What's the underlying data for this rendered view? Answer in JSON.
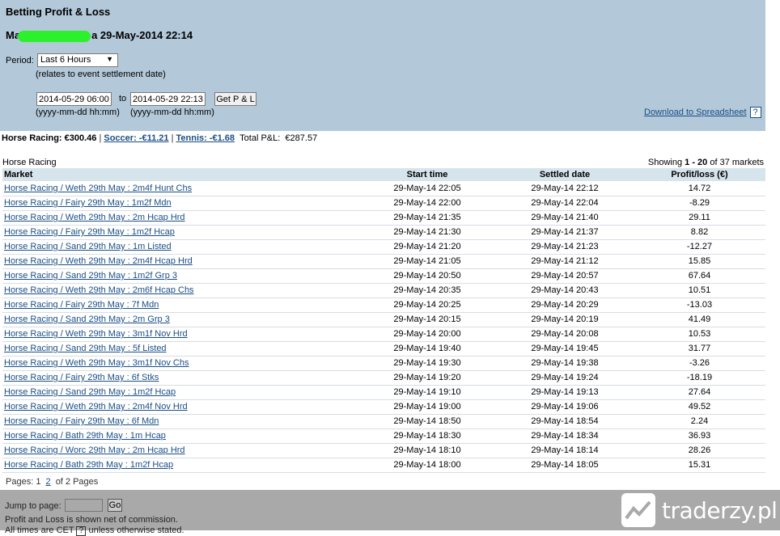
{
  "header": {
    "title": "Betting Profit & Loss",
    "account_prefix": "Ma",
    "account_suffix": "a 29-May-2014 22:14",
    "period_label": "Period:",
    "period_value": "Last 6 Hours",
    "period_note": "(relates to event settlement date)",
    "date_from": "2014-05-29 06:00",
    "to_label": "to",
    "date_to": "2014-05-29 22:13",
    "get_button": "Get P & L",
    "format_hint_from": "(yyyy-mm-dd hh:mm)",
    "format_hint_to": "(yyyy-mm-dd hh:mm)",
    "download_link": "Download to Spreadsheet",
    "help_mark": "?"
  },
  "summary": {
    "horse_racing": "Horse Racing: €300.46",
    "soccer": "Soccer: -€11.21",
    "tennis": "Tennis: -€1.68",
    "total_label": "Total P&L:",
    "total_value": "€287.57",
    "separator": "|"
  },
  "section": {
    "title": "Horse Racing",
    "showing_prefix": "Showing",
    "showing_range": "1 - 20",
    "showing_suffix": "of 37 markets"
  },
  "table": {
    "headers": {
      "market": "Market",
      "start": "Start time",
      "settled": "Settled date",
      "pl": "Profit/loss (€)"
    },
    "rows": [
      {
        "market": "Horse Racing / Weth 29th May : 2m4f Hunt Chs",
        "start": "29-May-14 22:05",
        "settled": "29-May-14 22:12",
        "pl": "14.72"
      },
      {
        "market": "Horse Racing / Fairy 29th May : 1m2f Mdn",
        "start": "29-May-14 22:00",
        "settled": "29-May-14 22:04",
        "pl": "-8.29"
      },
      {
        "market": "Horse Racing / Weth 29th May : 2m Hcap Hrd",
        "start": "29-May-14 21:35",
        "settled": "29-May-14 21:40",
        "pl": "29.11"
      },
      {
        "market": "Horse Racing / Fairy 29th May : 1m2f Hcap",
        "start": "29-May-14 21:30",
        "settled": "29-May-14 21:37",
        "pl": "8.82"
      },
      {
        "market": "Horse Racing / Sand 29th May : 1m Listed",
        "start": "29-May-14 21:20",
        "settled": "29-May-14 21:23",
        "pl": "-12.27"
      },
      {
        "market": "Horse Racing / Weth 29th May : 2m4f Hcap Hrd",
        "start": "29-May-14 21:05",
        "settled": "29-May-14 21:12",
        "pl": "15.85"
      },
      {
        "market": "Horse Racing / Sand 29th May : 1m2f Grp 3",
        "start": "29-May-14 20:50",
        "settled": "29-May-14 20:57",
        "pl": "67.64"
      },
      {
        "market": "Horse Racing / Weth 29th May : 2m6f Hcap Chs",
        "start": "29-May-14 20:35",
        "settled": "29-May-14 20:43",
        "pl": "10.51"
      },
      {
        "market": "Horse Racing / Fairy 29th May : 7f Mdn",
        "start": "29-May-14 20:25",
        "settled": "29-May-14 20:29",
        "pl": "-13.03"
      },
      {
        "market": "Horse Racing / Sand 29th May : 2m Grp 3",
        "start": "29-May-14 20:15",
        "settled": "29-May-14 20:19",
        "pl": "41.49"
      },
      {
        "market": "Horse Racing / Weth 29th May : 3m1f Nov Hrd",
        "start": "29-May-14 20:00",
        "settled": "29-May-14 20:08",
        "pl": "10.53"
      },
      {
        "market": "Horse Racing / Sand 29th May : 5f Listed",
        "start": "29-May-14 19:40",
        "settled": "29-May-14 19:45",
        "pl": "31.77"
      },
      {
        "market": "Horse Racing / Weth 29th May : 3m1f Nov Chs",
        "start": "29-May-14 19:30",
        "settled": "29-May-14 19:38",
        "pl": "-3.26"
      },
      {
        "market": "Horse Racing / Fairy 29th May : 6f Stks",
        "start": "29-May-14 19:20",
        "settled": "29-May-14 19:24",
        "pl": "-18.19"
      },
      {
        "market": "Horse Racing / Sand 29th May : 1m2f Hcap",
        "start": "29-May-14 19:10",
        "settled": "29-May-14 19:13",
        "pl": "27.64"
      },
      {
        "market": "Horse Racing / Weth 29th May : 2m4f Nov Hrd",
        "start": "29-May-14 19:00",
        "settled": "29-May-14 19:06",
        "pl": "49.52"
      },
      {
        "market": "Horse Racing / Fairy 29th May : 6f Mdn",
        "start": "29-May-14 18:50",
        "settled": "29-May-14 18:54",
        "pl": "2.24"
      },
      {
        "market": "Horse Racing / Bath 29th May : 1m Hcap",
        "start": "29-May-14 18:30",
        "settled": "29-May-14 18:34",
        "pl": "36.93"
      },
      {
        "market": "Horse Racing / Worc 29th May : 2m Hcap Hrd",
        "start": "29-May-14 18:10",
        "settled": "29-May-14 18:14",
        "pl": "28.26"
      },
      {
        "market": "Horse Racing / Bath 29th May : 1m2f Hcap",
        "start": "29-May-14 18:00",
        "settled": "29-May-14 18:05",
        "pl": "15.31"
      }
    ]
  },
  "pagination": {
    "label": "Pages:",
    "current": "1",
    "next": "2",
    "suffix": "of 2 Pages"
  },
  "footer": {
    "jump_label": "Jump to page:",
    "go_button": "Go",
    "commission_note": "Profit and Loss is shown net of commission.",
    "timezone_prefix": "All times are CET",
    "timezone_help": "?",
    "timezone_suffix": "unless otherwise stated."
  },
  "watermark": {
    "text": "traderzy.pl",
    "icon": "chart-trend-icon"
  },
  "colors": {
    "header_bg": "#b3c8d8",
    "table_header_bg": "#d6e4ec",
    "link": "#1a4e86",
    "footer_bg": "#a9a9a9",
    "redaction": "#2cf02c"
  }
}
